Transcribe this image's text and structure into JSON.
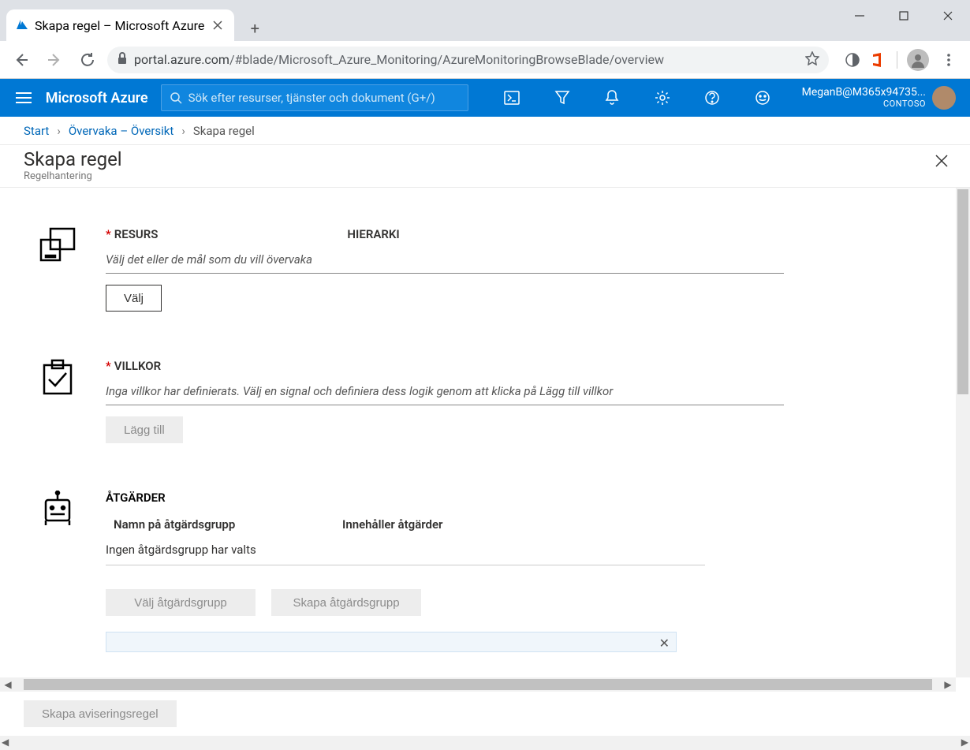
{
  "browser": {
    "tab_title": "Skapa regel – Microsoft Azure",
    "url_host": "portal.azure.com",
    "url_path": "/#blade/Microsoft_Azure_Monitoring/AzureMonitoringBrowseBlade/overview"
  },
  "azure_top": {
    "brand": "Microsoft Azure",
    "search_placeholder": "Sök efter resurser, tjänster och dokument (G+/)",
    "user_label": "MeganB@M365x94735...",
    "tenant": "CONTOSO"
  },
  "breadcrumb": {
    "start": "Start",
    "monitor": "Övervaka – Översikt",
    "current": "Skapa regel"
  },
  "blade": {
    "title": "Skapa regel",
    "subtitle": "Regelhantering"
  },
  "resource": {
    "label": "RESURS",
    "hierarchy": "HIERARKI",
    "placeholder": "Välj det eller de mål som du vill övervaka",
    "button": "Välj"
  },
  "condition": {
    "label": "VILLKOR",
    "placeholder": "Inga villkor har definierats. Välj en signal och definiera dess logik genom att klicka på Lägg till villkor",
    "button": "Lägg till"
  },
  "actions": {
    "label": "ÅTGÄRDER",
    "col_name": "Namn på åtgärdsgrupp",
    "col_contains": "Innehåller åtgärder",
    "empty": "Ingen åtgärdsgrupp har valts",
    "btn_select": "Välj åtgärdsgrupp",
    "btn_create": "Skapa åtgärdsgrupp"
  },
  "footer": {
    "create_btn": "Skapa aviseringsregel"
  }
}
